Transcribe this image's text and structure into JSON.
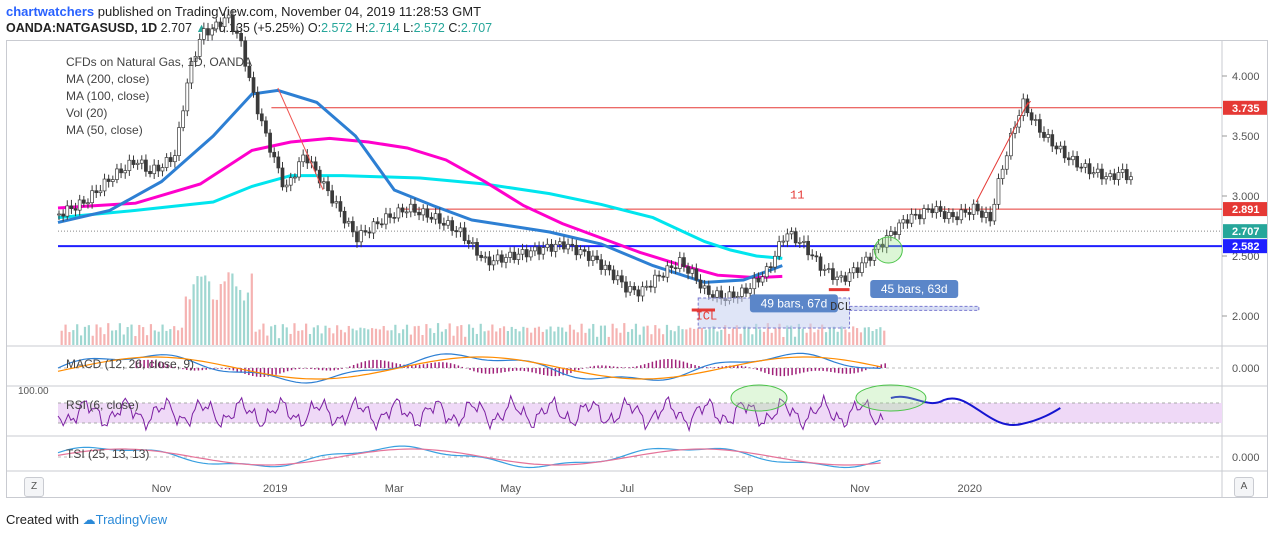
{
  "header": {
    "user": "chartwatchers",
    "published_text": " published on TradingView.com, November 04, 2019 11:28:53 GMT",
    "symbol": "OANDA:NATGASUSD, 1D",
    "last": "2.707",
    "change": "+0.135 (+5.25%)",
    "o_label": "O:",
    "o": "2.572",
    "h_label": "H:",
    "h": "2.714",
    "l_label": "L:",
    "l": "2.572",
    "c_label": "C:",
    "c": "2.707"
  },
  "legend": {
    "instrument": "CFDs on Natural Gas, 1D, OANDA",
    "ma200": "MA (200, close)",
    "ma100": "MA (100, close)",
    "vol": "Vol (20)",
    "ma50": "MA (50, close)"
  },
  "panes": {
    "macd": "MACD (12, 26, close, 9)",
    "rsi": "RSI (6, close)",
    "rsi_top_label": "100.00",
    "tsi": "TSI (25, 13, 13)"
  },
  "footer": {
    "created_with": "Created with",
    "brand": "TradingView"
  },
  "buttons": {
    "left": "Z",
    "right": "A"
  },
  "colors": {
    "up": "#26a69a",
    "down": "#ef5350",
    "ma50": "#00e5ee",
    "ma100": "#ff00cc",
    "ma200": "#2d7fd3",
    "hline_red": "#e53935",
    "hline_blue": "#1f1fff",
    "candle": "#3a3a3a"
  },
  "chart_data": {
    "type": "candlestick",
    "symbol": "OANDA:NATGASUSD",
    "timeframe": "1D",
    "ylim": [
      1.75,
      4.25
    ],
    "y_ticks": [
      "4.000",
      "3.500",
      "3.000",
      "2.500",
      "2.000"
    ],
    "x_ticks": [
      "Nov",
      "2019",
      "Mar",
      "May",
      "Jul",
      "Sep",
      "Nov",
      "2020"
    ],
    "price_tags": [
      {
        "value": "3.735",
        "color": "#e53935"
      },
      {
        "value": "2.891",
        "color": "#e53935"
      },
      {
        "value": "2.707",
        "color": "#26a69a"
      },
      {
        "value": "2.582",
        "color": "#1f1fff"
      }
    ],
    "horizontal_lines": [
      {
        "value": 3.735,
        "color": "#e53935"
      },
      {
        "value": 2.891,
        "color": "#e53935"
      },
      {
        "value": 2.582,
        "color": "#1f1fff"
      }
    ],
    "price_path_days": [
      0,
      20,
      40,
      60,
      70,
      80,
      90,
      100,
      110,
      120,
      130,
      140,
      150,
      160,
      175,
      190,
      210,
      230,
      250,
      270,
      290,
      310,
      330,
      350,
      370,
      390,
      410,
      420,
      430,
      440,
      450,
      460,
      470,
      480,
      490,
      500,
      515,
      530,
      548,
      562,
      575,
      590,
      604,
      610,
      620,
      640,
      655,
      662,
      675,
      690,
      700,
      708,
      720,
      725,
      735,
      745,
      755,
      762,
      770,
      780,
      790,
      800,
      813,
      820,
      830
    ],
    "price_path_values": [
      2.85,
      2.95,
      3.15,
      3.3,
      3.2,
      3.25,
      3.35,
      4.0,
      4.35,
      4.4,
      4.5,
      4.3,
      3.85,
      3.5,
      3.05,
      3.35,
      3.0,
      2.65,
      2.8,
      2.9,
      2.82,
      2.7,
      2.45,
      2.5,
      2.55,
      2.6,
      2.5,
      2.42,
      2.33,
      2.22,
      2.2,
      2.3,
      2.38,
      2.45,
      2.35,
      2.2,
      2.15,
      2.2,
      2.38,
      2.7,
      2.6,
      2.4,
      2.3,
      2.34,
      2.42,
      2.65,
      2.81,
      2.83,
      2.9,
      2.82,
      2.86,
      2.9,
      2.8,
      3.05,
      3.45,
      3.78,
      3.6,
      3.5,
      3.42,
      3.32,
      3.25,
      3.2,
      3.15,
      3.2,
      3.15
    ],
    "ma50_days": [
      0,
      60,
      120,
      150,
      180,
      220,
      280,
      330,
      380,
      420,
      460,
      480,
      500,
      520,
      540,
      560
    ],
    "ma50_values": [
      2.82,
      2.88,
      2.95,
      3.08,
      3.17,
      3.17,
      3.15,
      3.1,
      3.02,
      2.93,
      2.82,
      2.72,
      2.62,
      2.55,
      2.5,
      2.48
    ],
    "ma100_days": [
      0,
      60,
      110,
      150,
      180,
      210,
      240,
      270,
      300,
      330,
      360,
      390,
      420,
      450,
      480,
      510,
      540,
      560
    ],
    "ma100_values": [
      2.9,
      2.94,
      3.1,
      3.38,
      3.45,
      3.48,
      3.45,
      3.4,
      3.3,
      3.12,
      2.92,
      2.77,
      2.65,
      2.53,
      2.43,
      2.34,
      2.32,
      2.33
    ],
    "ma200_days": [
      0,
      40,
      80,
      120,
      150,
      170,
      200,
      230,
      260,
      290,
      320,
      350,
      380,
      420,
      460,
      500,
      530,
      560
    ],
    "ma200_values": [
      2.78,
      2.88,
      3.12,
      3.5,
      3.85,
      3.88,
      3.78,
      3.5,
      3.05,
      2.92,
      2.8,
      2.75,
      2.7,
      2.6,
      2.42,
      2.28,
      2.3,
      2.42
    ],
    "annotations": [
      {
        "text": "49 bars, 67d",
        "type": "range-label"
      },
      {
        "text": "45 bars, 63d",
        "type": "range-label"
      },
      {
        "text": "ICL",
        "type": "label"
      },
      {
        "text": "DCL",
        "type": "label"
      },
      {
        "text": "11",
        "type": "label"
      }
    ]
  },
  "indicators": {
    "macd_ticks": [
      "0.000"
    ],
    "rsi_ticks": [],
    "tsi_ticks": [
      "0.000"
    ]
  }
}
